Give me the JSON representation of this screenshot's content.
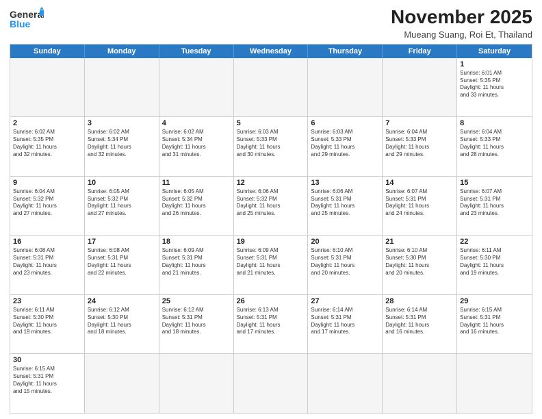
{
  "header": {
    "logo_general": "General",
    "logo_blue": "Blue",
    "month_title": "November 2025",
    "location": "Mueang Suang, Roi Et, Thailand"
  },
  "weekdays": [
    "Sunday",
    "Monday",
    "Tuesday",
    "Wednesday",
    "Thursday",
    "Friday",
    "Saturday"
  ],
  "weeks": [
    [
      {
        "day": "",
        "text": "",
        "empty": true
      },
      {
        "day": "",
        "text": "",
        "empty": true
      },
      {
        "day": "",
        "text": "",
        "empty": true
      },
      {
        "day": "",
        "text": "",
        "empty": true
      },
      {
        "day": "",
        "text": "",
        "empty": true
      },
      {
        "day": "",
        "text": "",
        "empty": true
      },
      {
        "day": "1",
        "text": "Sunrise: 6:01 AM\nSunset: 5:35 PM\nDaylight: 11 hours\nand 33 minutes."
      }
    ],
    [
      {
        "day": "2",
        "text": "Sunrise: 6:02 AM\nSunset: 5:35 PM\nDaylight: 11 hours\nand 32 minutes."
      },
      {
        "day": "3",
        "text": "Sunrise: 6:02 AM\nSunset: 5:34 PM\nDaylight: 11 hours\nand 32 minutes."
      },
      {
        "day": "4",
        "text": "Sunrise: 6:02 AM\nSunset: 5:34 PM\nDaylight: 11 hours\nand 31 minutes."
      },
      {
        "day": "5",
        "text": "Sunrise: 6:03 AM\nSunset: 5:33 PM\nDaylight: 11 hours\nand 30 minutes."
      },
      {
        "day": "6",
        "text": "Sunrise: 6:03 AM\nSunset: 5:33 PM\nDaylight: 11 hours\nand 29 minutes."
      },
      {
        "day": "7",
        "text": "Sunrise: 6:04 AM\nSunset: 5:33 PM\nDaylight: 11 hours\nand 29 minutes."
      },
      {
        "day": "8",
        "text": "Sunrise: 6:04 AM\nSunset: 5:33 PM\nDaylight: 11 hours\nand 28 minutes."
      }
    ],
    [
      {
        "day": "9",
        "text": "Sunrise: 6:04 AM\nSunset: 5:32 PM\nDaylight: 11 hours\nand 27 minutes."
      },
      {
        "day": "10",
        "text": "Sunrise: 6:05 AM\nSunset: 5:32 PM\nDaylight: 11 hours\nand 27 minutes."
      },
      {
        "day": "11",
        "text": "Sunrise: 6:05 AM\nSunset: 5:32 PM\nDaylight: 11 hours\nand 26 minutes."
      },
      {
        "day": "12",
        "text": "Sunrise: 6:06 AM\nSunset: 5:32 PM\nDaylight: 11 hours\nand 25 minutes."
      },
      {
        "day": "13",
        "text": "Sunrise: 6:06 AM\nSunset: 5:31 PM\nDaylight: 11 hours\nand 25 minutes."
      },
      {
        "day": "14",
        "text": "Sunrise: 6:07 AM\nSunset: 5:31 PM\nDaylight: 11 hours\nand 24 minutes."
      },
      {
        "day": "15",
        "text": "Sunrise: 6:07 AM\nSunset: 5:31 PM\nDaylight: 11 hours\nand 23 minutes."
      }
    ],
    [
      {
        "day": "16",
        "text": "Sunrise: 6:08 AM\nSunset: 5:31 PM\nDaylight: 11 hours\nand 23 minutes."
      },
      {
        "day": "17",
        "text": "Sunrise: 6:08 AM\nSunset: 5:31 PM\nDaylight: 11 hours\nand 22 minutes."
      },
      {
        "day": "18",
        "text": "Sunrise: 6:09 AM\nSunset: 5:31 PM\nDaylight: 11 hours\nand 21 minutes."
      },
      {
        "day": "19",
        "text": "Sunrise: 6:09 AM\nSunset: 5:31 PM\nDaylight: 11 hours\nand 21 minutes."
      },
      {
        "day": "20",
        "text": "Sunrise: 6:10 AM\nSunset: 5:31 PM\nDaylight: 11 hours\nand 20 minutes."
      },
      {
        "day": "21",
        "text": "Sunrise: 6:10 AM\nSunset: 5:30 PM\nDaylight: 11 hours\nand 20 minutes."
      },
      {
        "day": "22",
        "text": "Sunrise: 6:11 AM\nSunset: 5:30 PM\nDaylight: 11 hours\nand 19 minutes."
      }
    ],
    [
      {
        "day": "23",
        "text": "Sunrise: 6:11 AM\nSunset: 5:30 PM\nDaylight: 11 hours\nand 19 minutes."
      },
      {
        "day": "24",
        "text": "Sunrise: 6:12 AM\nSunset: 5:30 PM\nDaylight: 11 hours\nand 18 minutes."
      },
      {
        "day": "25",
        "text": "Sunrise: 6:12 AM\nSunset: 5:31 PM\nDaylight: 11 hours\nand 18 minutes."
      },
      {
        "day": "26",
        "text": "Sunrise: 6:13 AM\nSunset: 5:31 PM\nDaylight: 11 hours\nand 17 minutes."
      },
      {
        "day": "27",
        "text": "Sunrise: 6:14 AM\nSunset: 5:31 PM\nDaylight: 11 hours\nand 17 minutes."
      },
      {
        "day": "28",
        "text": "Sunrise: 6:14 AM\nSunset: 5:31 PM\nDaylight: 11 hours\nand 16 minutes."
      },
      {
        "day": "29",
        "text": "Sunrise: 6:15 AM\nSunset: 5:31 PM\nDaylight: 11 hours\nand 16 minutes."
      }
    ],
    [
      {
        "day": "30",
        "text": "Sunrise: 6:15 AM\nSunset: 5:31 PM\nDaylight: 11 hours\nand 15 minutes."
      },
      {
        "day": "",
        "text": "",
        "empty": true
      },
      {
        "day": "",
        "text": "",
        "empty": true
      },
      {
        "day": "",
        "text": "",
        "empty": true
      },
      {
        "day": "",
        "text": "",
        "empty": true
      },
      {
        "day": "",
        "text": "",
        "empty": true
      },
      {
        "day": "",
        "text": "",
        "empty": true
      }
    ]
  ]
}
